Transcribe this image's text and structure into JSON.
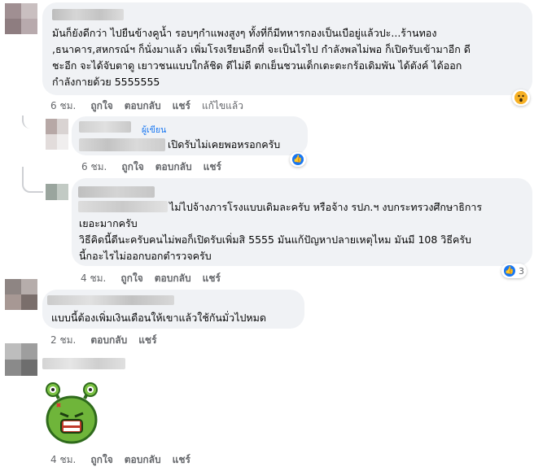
{
  "comments": [
    {
      "lines": [
        "มันก็ยังดีกว่า ไปยืนข้างคูน้ำ รอบๆกำแพงสูงๆ ทั้งที่ก็มีทหารกองเป็นเบือยู่แล้วปะ...ร้านทอง",
        ",ธนาคาร,สหกรณ์ฯ ก็นั่งมาแล้ว เพิ่มโรงเรียนอีกที่ จะเป็นไรไป กำลังพลไม่พอ ก็เปิดรับเข้ามาอีก ดี",
        "ชะอีก จะได้จับตาดู เยาวชนแบบใกล้ชิด ดีไม่ดี ตกเย็นชวนเด็กเตะตะกร้อเดิมพัน ได้ตังค์ ได้ออก",
        "กำลังกายด้วย 5555555"
      ],
      "time": "6 ชม.",
      "like": "ถูกใจ",
      "reply": "ตอบกลับ",
      "share": "แชร์",
      "edited": "แก้ไขแล้ว",
      "reaction": "wow-icon"
    },
    {
      "author_badge": "ผู้เขียน",
      "text": "เปิดรับไม่เคยพอหรอกครับ",
      "time": "6 ชม.",
      "like": "ถูกใจ",
      "reply": "ตอบกลับ",
      "share": "แชร์",
      "reaction": "like-icon"
    },
    {
      "lines": [
        "ไม่ไปจ้างภารโรงแบบเดิมละครับ หรือจ้าง รปภ.ฯ งบกระทรวงศึกษาธิการ",
        "เยอะมากครับ",
        "วิธีคิดนี้ดีนะครับคนไม่พอก็เปิดรับเพิ่มสิ 5555 มันแก้ปัญหาปลายเหตุไหม มันมี 108 วิธีครับ",
        "นี้กอะไรไม่ออกบอกตำรวจครับ"
      ],
      "time": "4 ชม.",
      "like": "ถูกใจ",
      "reply": "ตอบกลับ",
      "share": "แชร์",
      "reaction": "like-icon",
      "reaction_count": "3"
    },
    {
      "text": "แบบนี้ต้องเพิ่มเงินเดือนให้เขาแล้วใช้กันมั่วไปหมด",
      "time": "2 ชม.",
      "reply": "ตอบกลับ",
      "share": "แชร์"
    },
    {
      "sticker": "green-alien-sticker",
      "time": "4 ชม.",
      "like": "ถูกใจ",
      "reply": "ตอบกลับ",
      "share": "แชร์"
    }
  ]
}
